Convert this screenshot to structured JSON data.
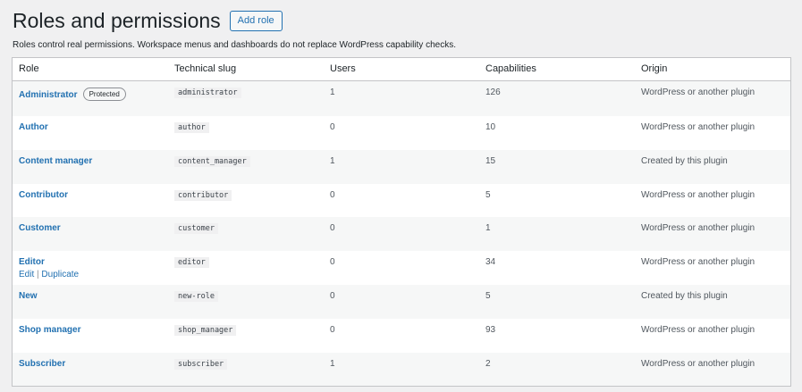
{
  "page": {
    "title": "Roles and permissions",
    "add_role_label": "Add role",
    "description": "Roles control real permissions. Workspace menus and dashboards do not replace WordPress capability checks."
  },
  "table": {
    "columns": [
      "Role",
      "Technical slug",
      "Users",
      "Capabilities",
      "Origin"
    ],
    "rows": [
      {
        "name": "Administrator",
        "badge": "Protected",
        "slug": "administrator",
        "users": "1",
        "capabilities": "126",
        "origin": "WordPress or another plugin"
      },
      {
        "name": "Author",
        "slug": "author",
        "users": "0",
        "capabilities": "10",
        "origin": "WordPress or another plugin"
      },
      {
        "name": "Content manager",
        "slug": "content_manager",
        "users": "1",
        "capabilities": "15",
        "origin": "Created by this plugin"
      },
      {
        "name": "Contributor",
        "slug": "contributor",
        "users": "0",
        "capabilities": "5",
        "origin": "WordPress or another plugin"
      },
      {
        "name": "Customer",
        "slug": "customer",
        "users": "0",
        "capabilities": "1",
        "origin": "WordPress or another plugin"
      },
      {
        "name": "Editor",
        "slug": "editor",
        "users": "0",
        "capabilities": "34",
        "origin": "WordPress or another plugin",
        "actions": {
          "edit": "Edit",
          "separator": "|",
          "duplicate": "Duplicate"
        }
      },
      {
        "name": "New",
        "slug": "new-role",
        "users": "0",
        "capabilities": "5",
        "origin": "Created by this plugin"
      },
      {
        "name": "Shop manager",
        "slug": "shop_manager",
        "users": "0",
        "capabilities": "93",
        "origin": "WordPress or another plugin"
      },
      {
        "name": "Subscriber",
        "slug": "subscriber",
        "users": "1",
        "capabilities": "2",
        "origin": "WordPress or another plugin"
      }
    ]
  },
  "colors": {
    "link": "#2271b1",
    "background": "#f0f0f1",
    "row_alt": "#f6f7f7",
    "border": "#c3c4c7"
  }
}
